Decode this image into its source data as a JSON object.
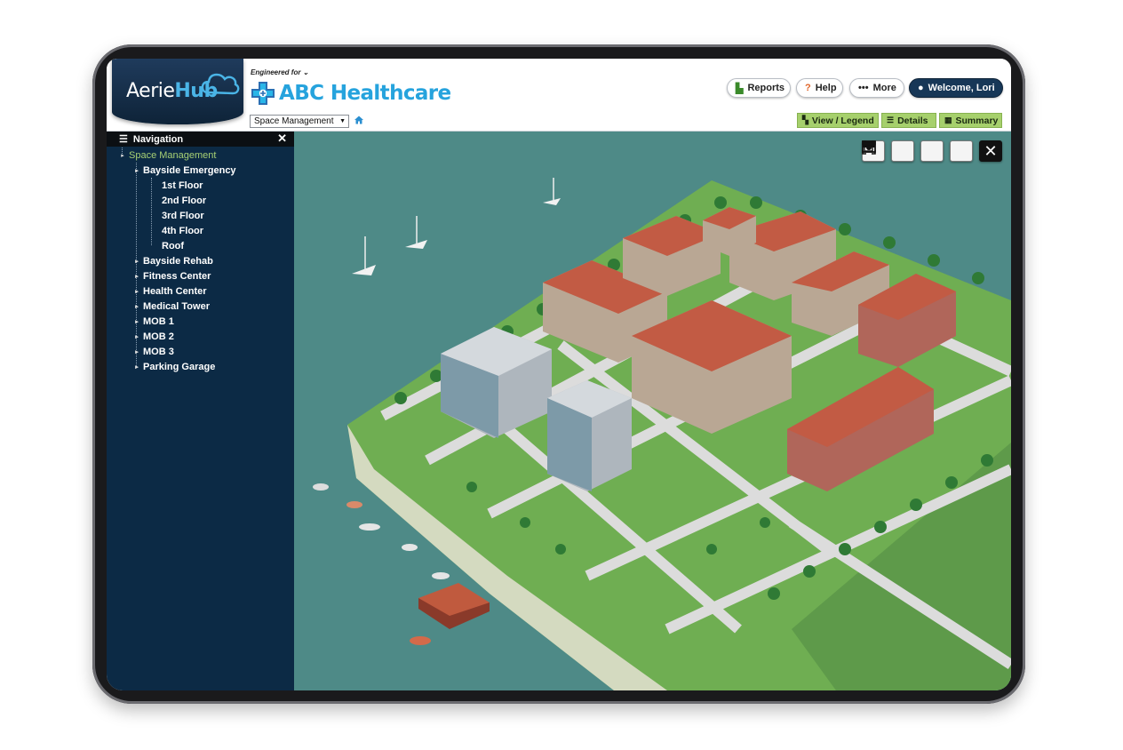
{
  "branding": {
    "app_name_part1": "Aerie",
    "app_name_part2": "Hub",
    "engineered_for": "Engineered for",
    "client_name": "ABC Healthcare"
  },
  "header": {
    "reports_label": "Reports",
    "help_label": "Help",
    "more_label": "More",
    "welcome_label": "Welcome, Lori"
  },
  "subbar": {
    "module_value": "Space Management",
    "view_legend_label": "View / Legend",
    "details_label": "Details",
    "summary_label": "Summary"
  },
  "navigation": {
    "title": "Navigation",
    "root": "Space Management",
    "items": [
      {
        "label": "Bayside Emergency",
        "expanded": true,
        "children": [
          "1st Floor",
          "2nd Floor",
          "3rd Floor",
          "4th Floor",
          "Roof"
        ]
      },
      {
        "label": "Bayside Rehab",
        "expanded": false
      },
      {
        "label": "Fitness Center",
        "expanded": false
      },
      {
        "label": "Health Center",
        "expanded": false
      },
      {
        "label": "Medical Tower",
        "expanded": false
      },
      {
        "label": "MOB 1",
        "expanded": false
      },
      {
        "label": "MOB 2",
        "expanded": false
      },
      {
        "label": "MOB 3",
        "expanded": false
      },
      {
        "label": "Parking Garage",
        "expanded": false
      }
    ]
  },
  "map_tools": [
    "layout-left-icon",
    "layout-right-icon",
    "layout-split-icon",
    "fullscreen-icon",
    "close-icon"
  ],
  "colors": {
    "brand_blue": "#26a3dd",
    "nav_bg": "#0c2a45",
    "accent_green": "#a6d06c",
    "welcome_bg": "#173757",
    "water": "#4e8a87",
    "grass": "#6fae52",
    "roof_red": "#c25b44"
  }
}
